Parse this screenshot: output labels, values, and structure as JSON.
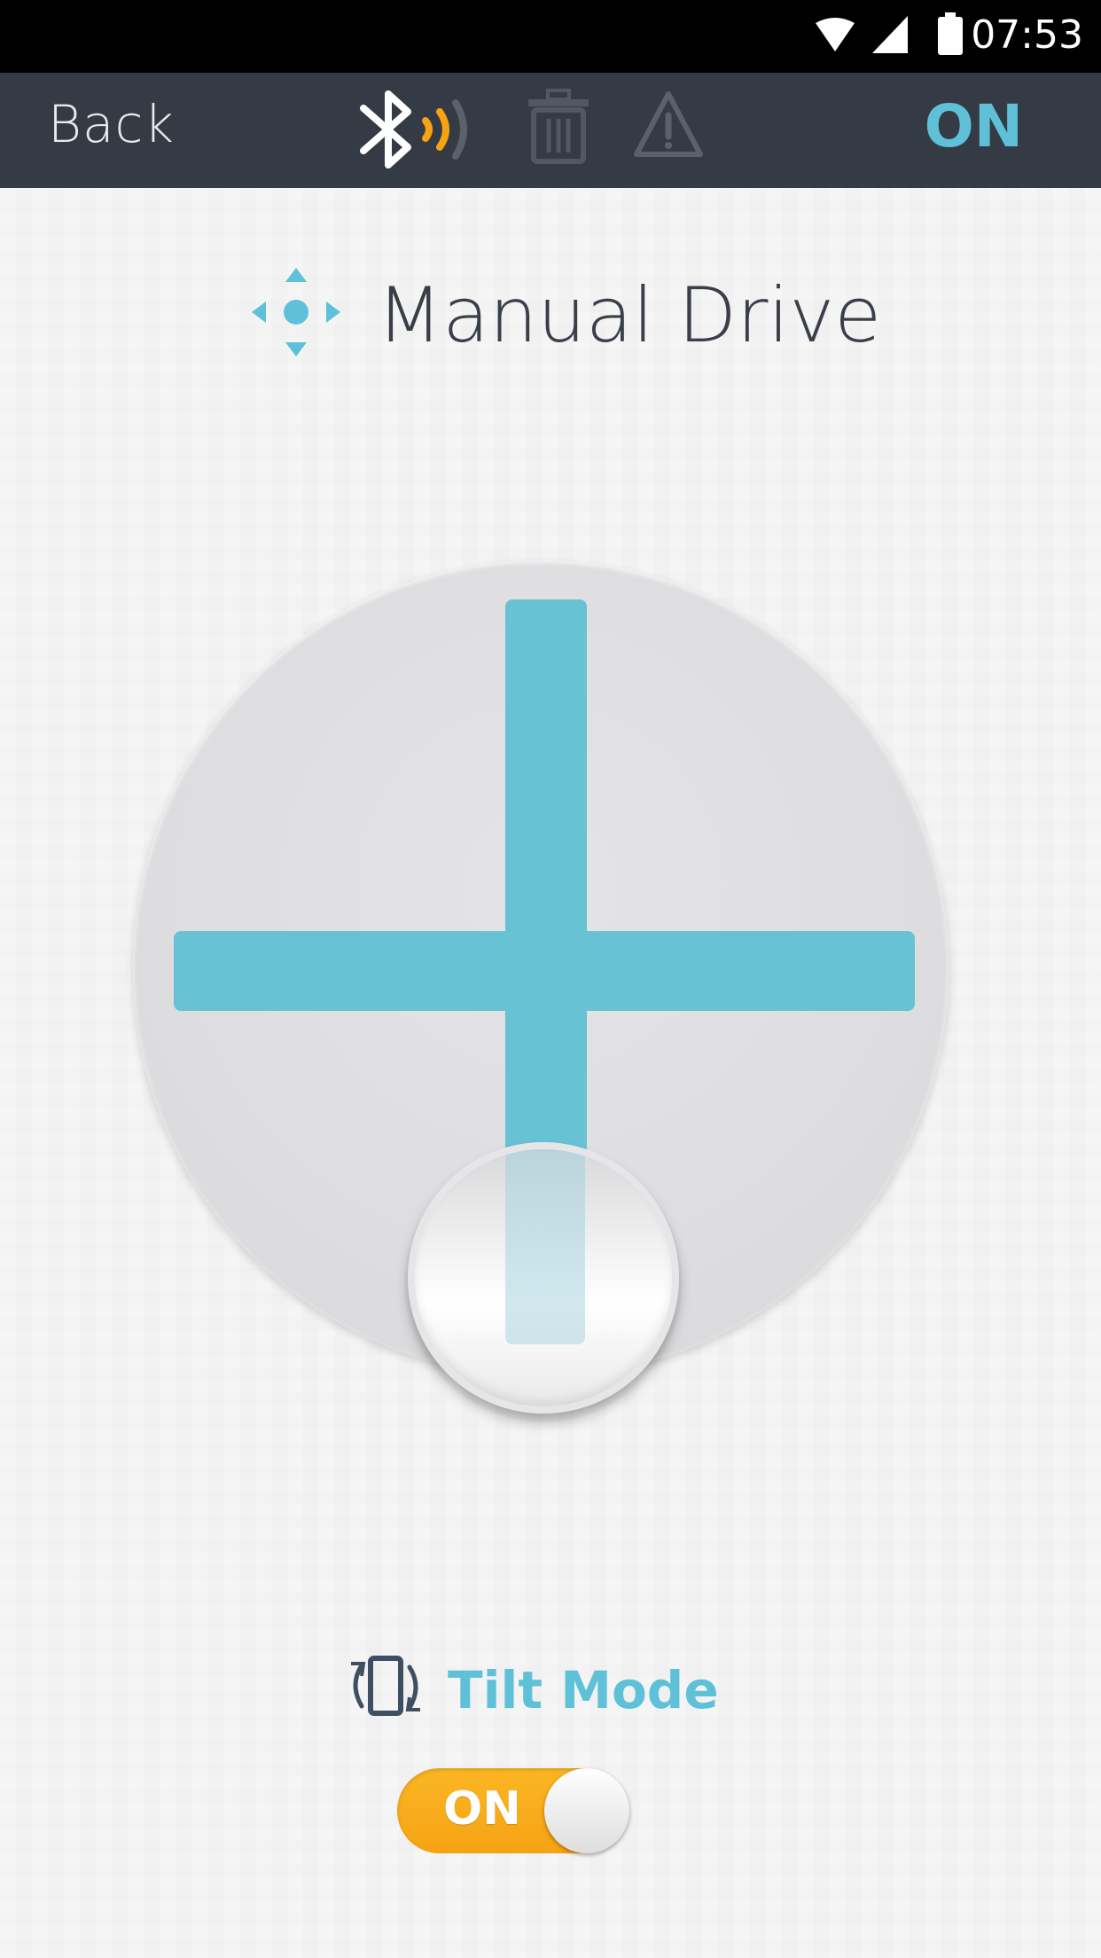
{
  "status_bar": {
    "time": "07:53",
    "icons": [
      "wifi-icon",
      "cell-signal-icon",
      "battery-icon"
    ]
  },
  "app_bar": {
    "back_label": "Back",
    "power_label": "ON",
    "icons": [
      "bluetooth-connected-icon",
      "trash-icon",
      "warning-icon"
    ]
  },
  "header": {
    "title": "Manual Drive",
    "icon": "dpad-arrows-icon"
  },
  "tilt": {
    "label": "Tilt Mode",
    "icon": "rotate-phone-icon",
    "toggle_label": "ON"
  },
  "colors": {
    "accent": "#5ec1d8",
    "toggle_on": "#f6a313",
    "app_bar": "#353b44"
  }
}
